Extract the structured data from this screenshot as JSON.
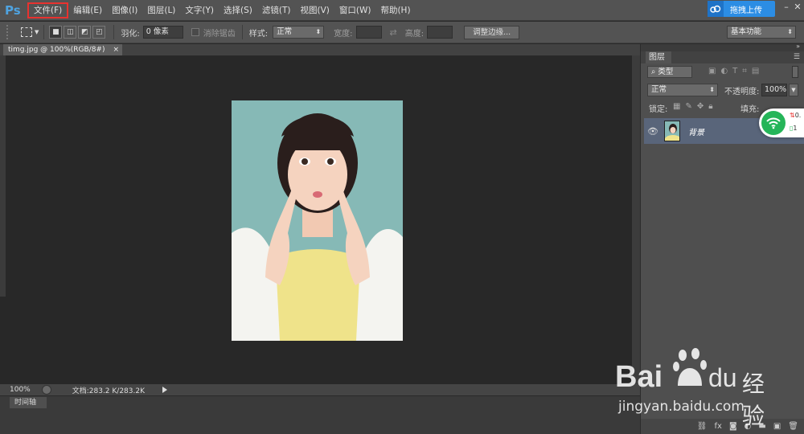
{
  "app": {
    "logo": "Ps"
  },
  "menu": [
    {
      "label": "文件(F)",
      "active": true
    },
    {
      "label": "编辑(E)"
    },
    {
      "label": "图像(I)"
    },
    {
      "label": "图层(L)"
    },
    {
      "label": "文字(Y)"
    },
    {
      "label": "选择(S)"
    },
    {
      "label": "滤镜(T)"
    },
    {
      "label": "视图(V)"
    },
    {
      "label": "窗口(W)"
    },
    {
      "label": "帮助(H)"
    }
  ],
  "upload": {
    "label": "拖拽上传"
  },
  "options": {
    "feather_label": "羽化:",
    "feather_value": "0 像素",
    "antialias_label": "消除锯齿",
    "style_label": "样式:",
    "style_value": "正常",
    "width_label": "宽度:",
    "height_label": "高度:",
    "refine_edge": "调整边缘...",
    "workspace": "基本功能"
  },
  "document": {
    "tab_title": "timg.jpg @ 100%(RGB/8#)",
    "close": "×",
    "zoom": "100%",
    "doc_size": "文档:283.2 K/283.2K"
  },
  "timeline": {
    "label": "时间轴"
  },
  "layers_panel": {
    "title": "图层",
    "filter_type": "类型",
    "blend_mode": "正常",
    "opacity_label": "不透明度:",
    "opacity_value": "100%",
    "lock_label": "锁定:",
    "fill_label": "填充:",
    "layers": [
      {
        "name": "背景",
        "visible": true
      }
    ]
  },
  "overlay": {
    "wifi_top": "0.",
    "wifi_bottom": "1"
  },
  "watermark": {
    "brand": "Bai",
    "brand2": "du",
    "brand_cn": "经验",
    "url": "jingyan.baidu.com"
  },
  "colors": {
    "menu_bg": "#535353",
    "canvas_bg": "#282828",
    "highlight": "#e8322f",
    "accent": "#2c8de4",
    "selected_layer": "#59657a",
    "wifi": "#25b559"
  }
}
